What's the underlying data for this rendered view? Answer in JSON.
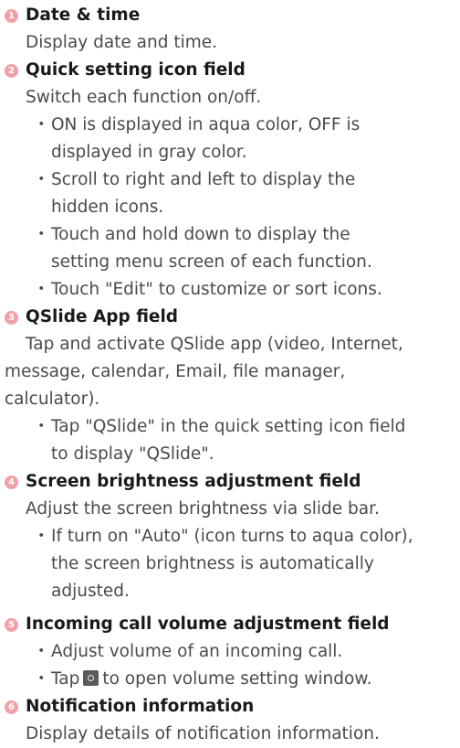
{
  "accent_color": "#f2a0a8",
  "sections": [
    {
      "number": "1",
      "title": "Date & time",
      "desc": [
        "Display date and time."
      ],
      "bullets": []
    },
    {
      "number": "2",
      "title": "Quick setting icon field",
      "desc": [
        "Switch each function on/off."
      ],
      "bullets": [
        [
          "ON is displayed in aqua color, OFF is",
          "displayed in gray color."
        ],
        [
          "Scroll to right and left to display the",
          "hidden icons."
        ],
        [
          "Touch and hold down to display the",
          "setting menu screen of each function."
        ],
        [
          "Touch \"Edit\" to customize or sort icons."
        ]
      ]
    },
    {
      "number": "3",
      "title": "QSlide App field",
      "desc": [
        "Tap and activate QSlide app (video, Internet,",
        "message, calendar, Email, file manager,",
        "calculator)."
      ],
      "bullets": [
        [
          "Tap \"QSlide\" in the quick setting icon field",
          "to display \"QSlide\"."
        ]
      ]
    },
    {
      "number": "4",
      "title": "Screen brightness adjustment field",
      "desc": [
        "Adjust the screen brightness via slide bar."
      ],
      "bullets": [
        [
          "If turn on \"Auto\" (icon turns to aqua color),",
          "the screen brightness is automatically",
          "adjusted."
        ]
      ]
    },
    {
      "number": "5",
      "title": "Incoming call volume adjustment field",
      "desc": [],
      "bullets": [
        [
          "Adjust volume of an incoming call."
        ]
      ],
      "icon_bullet": {
        "before": "Tap",
        "icon": "gear-icon",
        "after": "to open volume setting window."
      }
    },
    {
      "number": "6",
      "title": "Notification information",
      "desc": [
        "Display details of notification information."
      ],
      "bullets": []
    }
  ],
  "bullet_char": "・"
}
